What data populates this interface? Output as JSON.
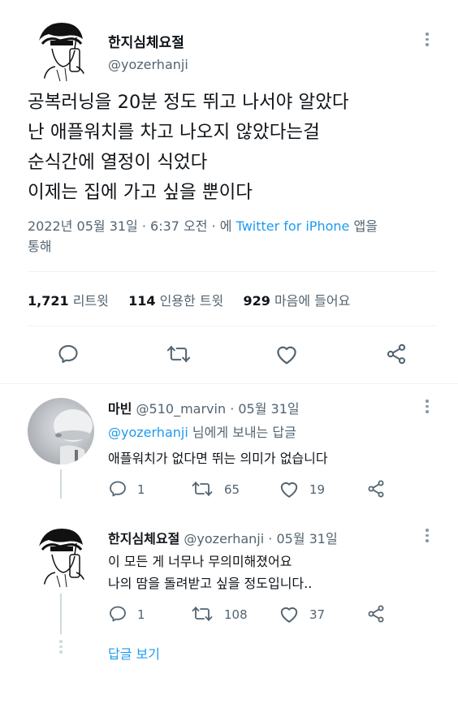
{
  "main_tweet": {
    "display_name": "한지심체요절",
    "handle": "@yozerhanji",
    "text_lines": [
      "공복러닝을 20분 정도 뛰고 나서야 알았다",
      "난 애플워치를 차고 나오지 않았다는걸",
      "순식간에 열정이 식었다",
      "이제는 집에 가고 싶을 뿐이다"
    ],
    "meta_prefix": "2022년 05월 31일 · 6:37 오전 · 에",
    "source_link": "Twitter for iPhone",
    "meta_suffix_1": "앱을",
    "meta_suffix_2": "통해",
    "stats": {
      "retweets_count": "1,721",
      "retweets_label": "리트윗",
      "quotes_count": "114",
      "quotes_label": "인용한 트윗",
      "likes_count": "929",
      "likes_label": "마음에 들어요"
    }
  },
  "replies": [
    {
      "display_name": "마빈",
      "handle_time": "@510_marvin · 05월 31일",
      "reply_to_handle": "@yozerhanji",
      "reply_to_suffix": "님에게 보내는 답글",
      "text": "애플워치가 없다면 뛰는 의미가 없습니다",
      "reply_count": "1",
      "retweet_count": "65",
      "like_count": "19"
    },
    {
      "display_name": "한지심체요절",
      "handle_time": "@yozerhanji · 05월 31일",
      "text_lines": [
        "이 모든 게 너무나 무의미해졌어요",
        "나의 땀을 돌려받고 싶을 정도입니다.."
      ],
      "reply_count": "1",
      "retweet_count": "108",
      "like_count": "37"
    }
  ],
  "show_replies_label": "답글 보기",
  "colors": {
    "accent": "#1d9bf0",
    "text": "#0f1419",
    "muted": "#536471",
    "divider": "#eff3f4"
  }
}
